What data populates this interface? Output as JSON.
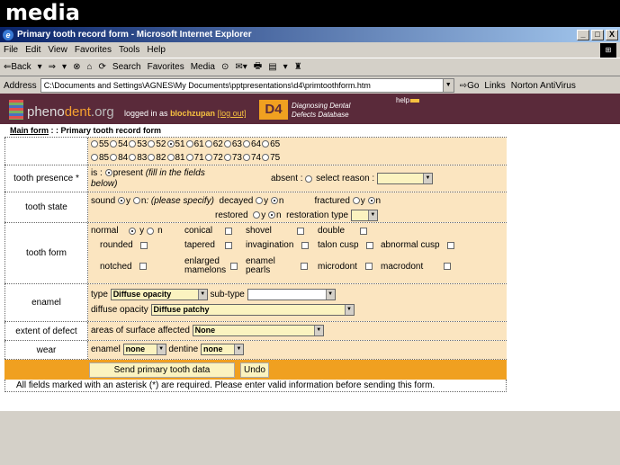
{
  "logo": "media",
  "window": {
    "title": "Primary tooth record form - Microsoft Internet Explorer",
    "buttons": [
      "_",
      "□",
      "X"
    ]
  },
  "menu": [
    "File",
    "Edit",
    "View",
    "Favorites",
    "Tools",
    "Help"
  ],
  "toolbar": [
    "⇐Back",
    "▾",
    "⇒",
    "▾",
    "⊗",
    "⌂",
    "⟳",
    "Search",
    "Favorites",
    "Media",
    "⊙",
    "✉▾",
    "🖶",
    "▤",
    "▾",
    "♜"
  ],
  "address": {
    "label": "Address",
    "value": "C:\\Documents and Settings\\AGNES\\My Documents\\pptpresentations\\d4\\primtoothform.htm",
    "go": "Go",
    "links": "Links",
    "norton": "Norton AntiVirus"
  },
  "banner": {
    "site_a": "pheno",
    "site_b": "dent",
    "site_c": ".org",
    "logged_in_as": "logged in as",
    "user": "blochzupan",
    "logout": "[log out]",
    "d4": "D4",
    "ddd_line1": "Diagnosing Dental",
    "ddd_line2": "Defects Database",
    "help": "help"
  },
  "breadcrumb": {
    "main": "Main form",
    "rest": " : : Primary tooth record form"
  },
  "teeth": {
    "upper": [
      "55",
      "54",
      "53",
      "52",
      "51",
      "61",
      "62",
      "63",
      "64",
      "65"
    ],
    "lower": [
      "85",
      "84",
      "83",
      "82",
      "81",
      "71",
      "72",
      "73",
      "74",
      "75"
    ],
    "selected": "51"
  },
  "presence": {
    "label": "tooth presence *",
    "is": "is :",
    "present": "present",
    "present_note": "(fill in the fields",
    "present_note2": "below)",
    "absent": "absent :",
    "select_reason": "select reason :"
  },
  "state": {
    "label": "tooth state",
    "sound": "sound",
    "y": "y",
    "n": "n",
    "sound_note": ": (please specify)",
    "decayed": "decayed",
    "fractured": "fractured",
    "restored": "restored",
    "restoration_type": "restoration type"
  },
  "form_row": {
    "label": "tooth form",
    "normal": "normal",
    "y": "y",
    "n": "n",
    "items": [
      "conical",
      "shovel",
      "double",
      "rounded",
      "tapered",
      "invagination",
      "talon cusp",
      "abnormal cusp",
      "notched",
      "enlarged mamelons",
      "enamel pearls",
      "microdont",
      "macrodont"
    ]
  },
  "enamel": {
    "label": "enamel",
    "type": "type",
    "type_value": "Diffuse opacity",
    "subtype": "sub-type",
    "diffuse_opacity": "diffuse opacity",
    "diffuse_value": "Diffuse patchy"
  },
  "extent": {
    "label": "extent of defect",
    "areas": "areas of surface affected",
    "areas_value": "None"
  },
  "wear": {
    "label": "wear",
    "enamel": "enamel",
    "enamel_value": "none",
    "dentine": "dentine",
    "dentine_value": "none"
  },
  "buttons": {
    "send": "Send primary tooth data",
    "undo": "Undo"
  },
  "note": "All fields marked with an asterisk (*) are required. Please enter valid information before sending this form."
}
